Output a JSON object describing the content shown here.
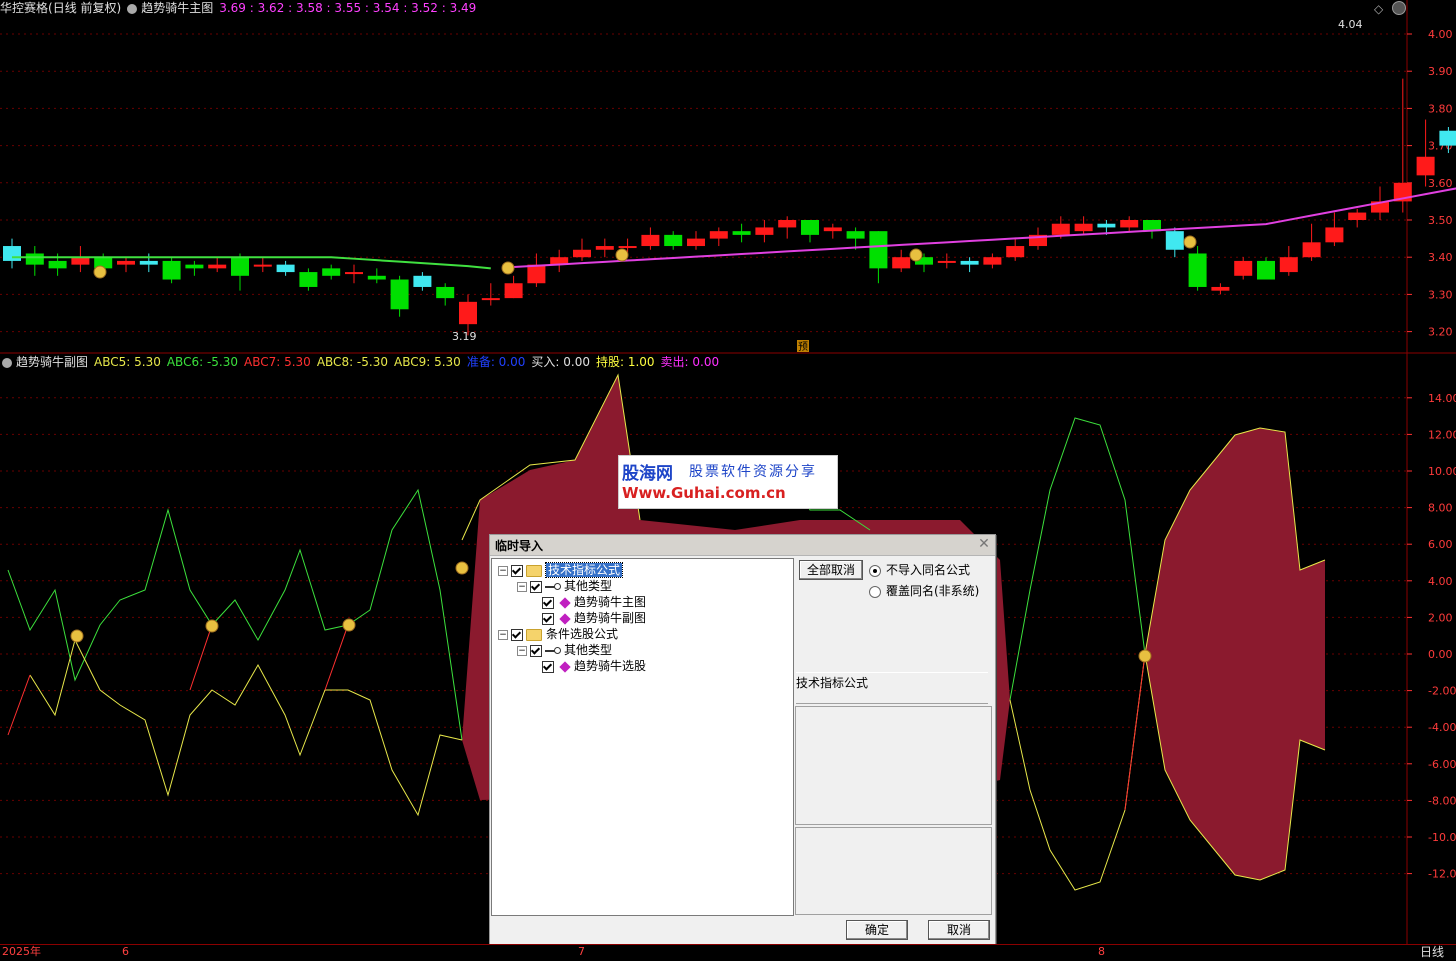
{
  "main_chart": {
    "stock_name": "华控赛格",
    "period_label": "(日线 前复权)",
    "indicator_name": "趋势骑牛主图",
    "indicator_values": "3.69 : 3.62 : 3.58 : 3.55 : 3.54 : 3.52 : 3.49",
    "high_annotation": "4.04",
    "low_annotation": "3.19",
    "marker_label": "预",
    "price_axis": [
      "4.00",
      "3.90",
      "3.80",
      "3.70",
      "3.60",
      "3.50",
      "3.40",
      "3.30",
      "3.20"
    ]
  },
  "sub_chart": {
    "indicator_name": "趋势骑牛副图",
    "readouts": [
      {
        "label": "ABC5:",
        "value": "5.30",
        "color": "#e8e84a"
      },
      {
        "label": "ABC6:",
        "value": "-5.30",
        "color": "#3ce03c"
      },
      {
        "label": "ABC7:",
        "value": "5.30",
        "color": "#ff3030"
      },
      {
        "label": "ABC8:",
        "value": "-5.30",
        "color": "#e8e84a"
      },
      {
        "label": "ABC9:",
        "value": "5.30",
        "color": "#e8e84a"
      },
      {
        "label": "准备:",
        "value": "0.00",
        "color": "#2040ff"
      },
      {
        "label": "买入:",
        "value": "0.00",
        "color": "#e0e0e0"
      },
      {
        "label": "持股:",
        "value": "1.00",
        "color": "#ffff40"
      },
      {
        "label": "卖出:",
        "value": "0.00",
        "color": "#ff30ff"
      }
    ],
    "value_axis": [
      "14.00",
      "12.00",
      "10.00",
      "8.00",
      "6.00",
      "4.00",
      "2.00",
      "0.00",
      "-2.00",
      "-4.00",
      "-6.00",
      "-8.00",
      "-10.00",
      "-12.00"
    ]
  },
  "time_axis": {
    "labels": [
      {
        "text": "2025年",
        "slot": "a"
      },
      {
        "text": "6",
        "slot": "b"
      },
      {
        "text": "7",
        "slot": "c"
      },
      {
        "text": "8",
        "slot": "d"
      }
    ],
    "period": "日线"
  },
  "watermark": {
    "brand": "股海网",
    "slogan": "股票软件资源分享",
    "url": "Www.Guhai.com.cn"
  },
  "dialog": {
    "title": "临时导入",
    "tree": [
      {
        "label": "技术指标公式",
        "kind": "folder",
        "level": 0,
        "selected": true
      },
      {
        "label": "其他类型",
        "kind": "key",
        "level": 1
      },
      {
        "label": "趋势骑牛主图",
        "kind": "gem",
        "level": 2
      },
      {
        "label": "趋势骑牛副图",
        "kind": "gem",
        "level": 2
      },
      {
        "label": "条件选股公式",
        "kind": "folder",
        "level": 0
      },
      {
        "label": "其他类型",
        "kind": "key",
        "level": 1
      },
      {
        "label": "趋势骑牛选股",
        "kind": "gem",
        "level": 2
      }
    ],
    "cancel_all_label": "全部取消",
    "option_no_import_same": "不导入同名公式",
    "option_overwrite_same": "覆盖同名(非系统)",
    "selected_option": "no_import_same",
    "info_label": "技术指标公式",
    "ok_label": "确定",
    "cancel_label": "取消"
  },
  "colors": {
    "up": "#ff1a1a",
    "down_solid": "#00e000",
    "down_hollow": "#40e8f0",
    "ma_pink": "#e040e0",
    "ma_green": "#40e040",
    "fill": "#8b1a2e"
  }
}
